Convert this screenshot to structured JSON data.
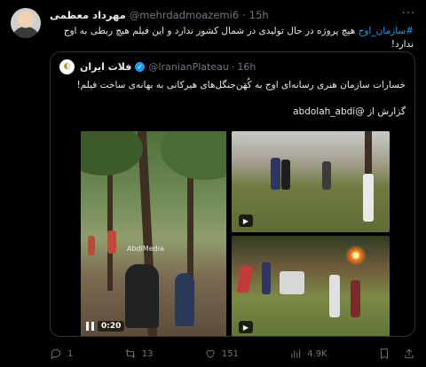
{
  "tweet": {
    "author_name": "مهرداد معظمی",
    "handle": "@mehrdadmoazemi6",
    "separator": "·",
    "time": "15h",
    "more": "···",
    "hashtag": "#سازمان_اوج",
    "text": " هیچ پروژه در حال تولیدی در شمال کشور ندارد و این فیلم هیچ ربطی به اوج ندارد!"
  },
  "quote": {
    "author_name": "فلات ایران",
    "handle": "@IranianPlateau",
    "separator": "·",
    "time": "16h",
    "avatar_icon": "plateau-logo-icon",
    "text1": "خسارات سازمان هنری رسانه‌ای اوج به کُهَن‌جنگل‌های هیرکانی به بهانه‌ی ساخت فیلم!",
    "text2": "گزارش از @abdolah_abdi",
    "video_time": "0:20",
    "watermark": "AbdiMedia"
  },
  "actions": {
    "reply_count": "1",
    "retweet_count": "13",
    "like_count": "151",
    "views_count": "4.9K"
  },
  "colors": {
    "background": "#000000",
    "text": "#e7e9ea",
    "muted": "#71767b",
    "accent": "#1d9bf0",
    "border": "#2f3336"
  }
}
